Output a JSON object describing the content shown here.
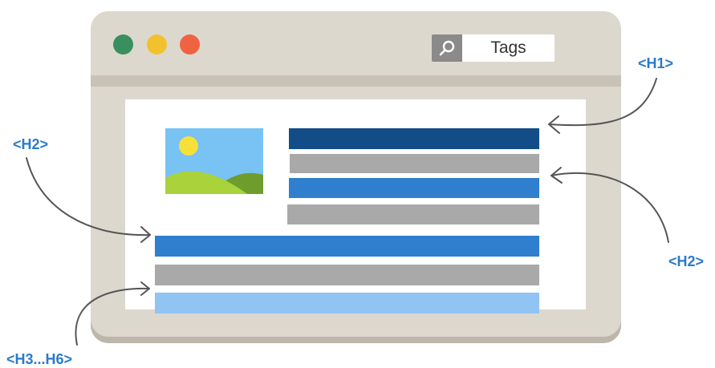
{
  "colors": {
    "window_bg": "#ddd8cd",
    "dot_green": "#3a8f5e",
    "dot_yellow": "#f2c12e",
    "dot_red": "#ef6343",
    "h1_bar": "#134d87",
    "h2_bar": "#2f7fce",
    "text_bar": "#a9a9a9",
    "h3_bar": "#90c4f2",
    "label": "#2b7bc8",
    "arrow": "#555555"
  },
  "toolbar": {
    "search_icon": "search-icon",
    "search_label": "Tags"
  },
  "thumbnail": {
    "icon": "landscape-image-icon"
  },
  "labels": {
    "h1_right": "<H1>",
    "h2_left": "<H2>",
    "h2_right": "<H2>",
    "h3_h6": "<H3...H6>"
  }
}
